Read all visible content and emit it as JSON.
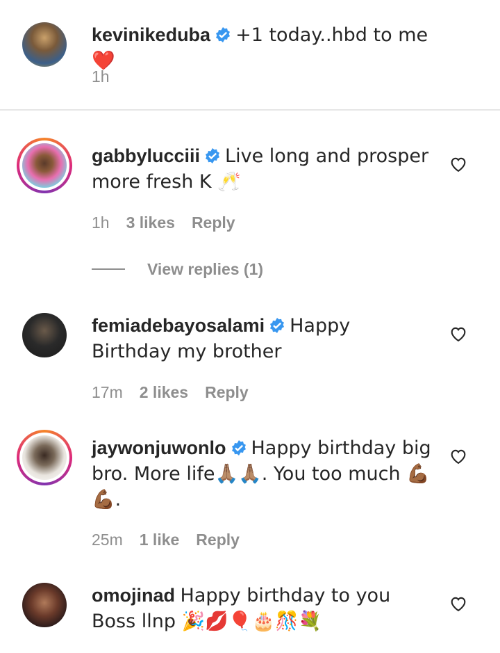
{
  "caption": {
    "username": "kevinikeduba",
    "text": "+1 today..hbd to me❤️",
    "time": "1h"
  },
  "comments": [
    {
      "username": "gabbylucciii",
      "text": "Live long and prosper more fresh K 🥂",
      "time": "1h",
      "likes": "3 likes",
      "reply_label": "Reply",
      "view_replies": "View replies (1)"
    },
    {
      "username": "femiadebayosalami",
      "text": "Happy Birthday my brother",
      "time": "17m",
      "likes": "2 likes",
      "reply_label": "Reply"
    },
    {
      "username": "jaywonjuwonlo",
      "text": "Happy birthday big bro. More life🙏🏽🙏🏽. You too much 💪🏾💪🏾.",
      "time": "25m",
      "likes": "1 like",
      "reply_label": "Reply"
    },
    {
      "username": "omojinad",
      "text": "Happy birthday to you Boss llnp 🎉💋🎈🎂🎊💐",
      "time": ""
    }
  ],
  "colors": {
    "verified": "#3897f0",
    "meta": "#8e8e8e",
    "text": "#262626"
  }
}
